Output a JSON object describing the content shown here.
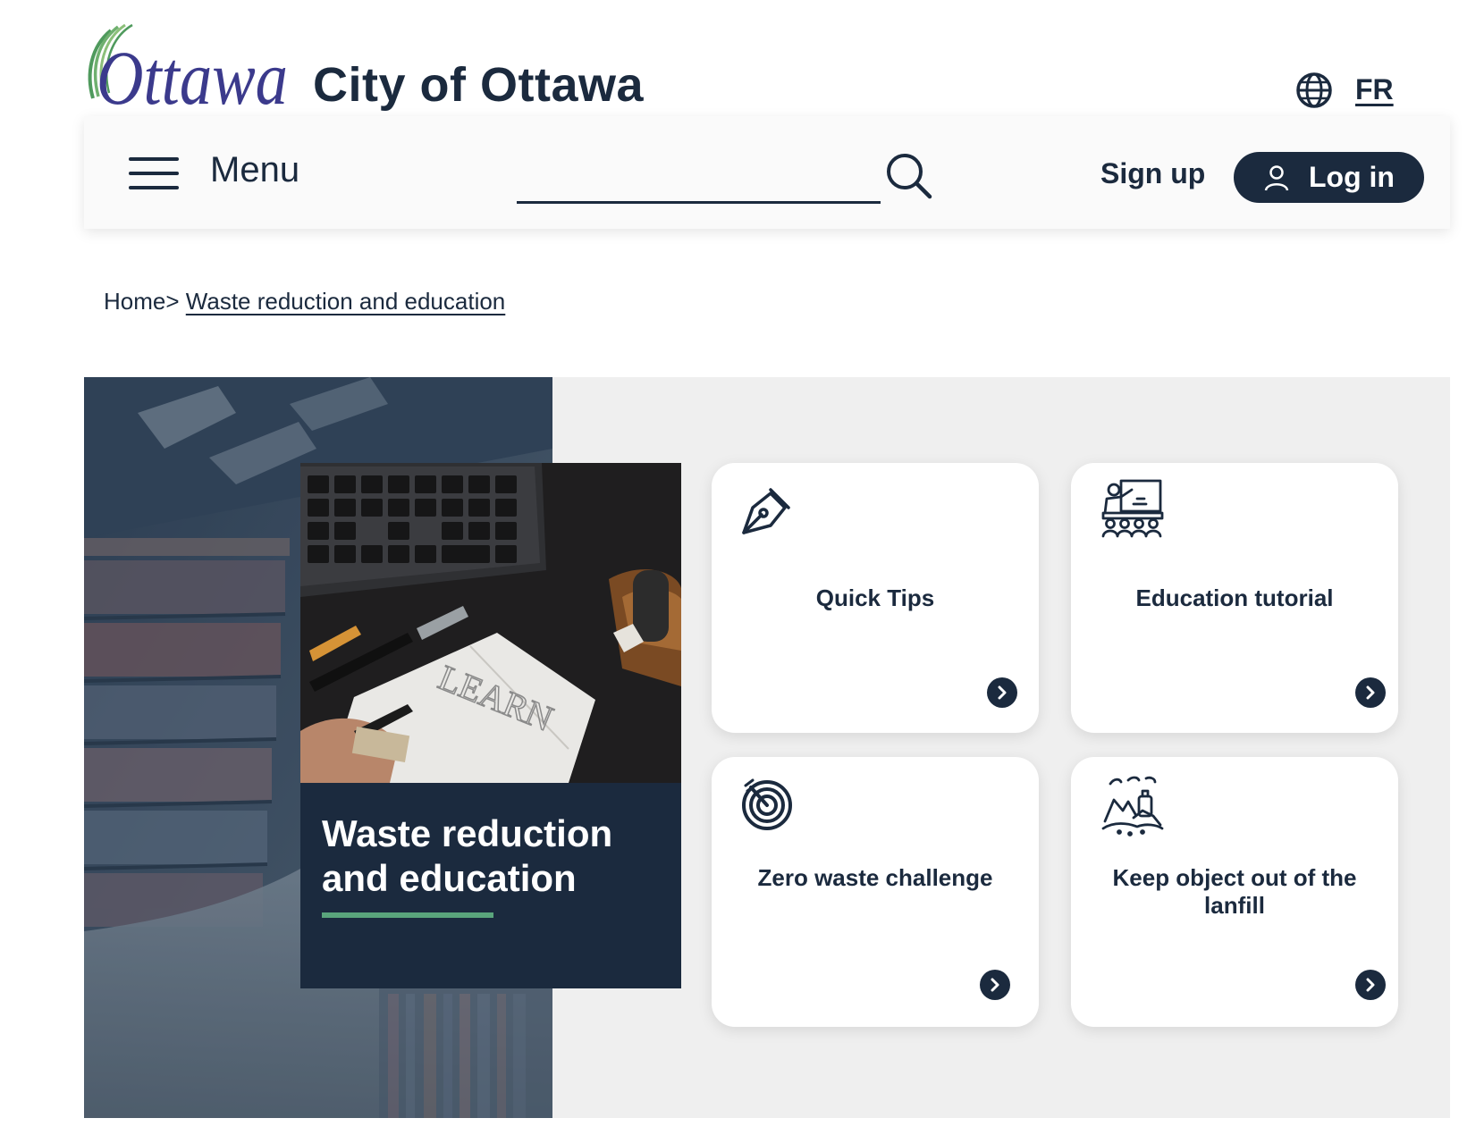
{
  "header": {
    "logo_text": "Ottawa",
    "site_title": "City of Ottawa",
    "language_link": "FR"
  },
  "nav": {
    "menu_label": "Menu",
    "search_value": "",
    "signup_label": "Sign up",
    "login_label": "Log in"
  },
  "breadcrumb": {
    "home": "Home>",
    "current": "Waste reduction and education"
  },
  "feature": {
    "photo_text": "LEARN",
    "title": "Waste reduction and education"
  },
  "cards": [
    {
      "label": "Quick Tips",
      "icon": "pen-nib-icon"
    },
    {
      "label": "Education tutorial",
      "icon": "classroom-teacher-icon"
    },
    {
      "label": "Zero waste challenge",
      "icon": "target-dart-icon"
    },
    {
      "label": "Keep object out of the lanfill",
      "icon": "landfill-waste-icon"
    }
  ],
  "colors": {
    "navy": "#1b2a3e",
    "accent_green": "#5aa57c",
    "logo_green": "#4f9a5d",
    "logo_blue": "#3b3a8c",
    "hero_bg": "#efefef"
  }
}
